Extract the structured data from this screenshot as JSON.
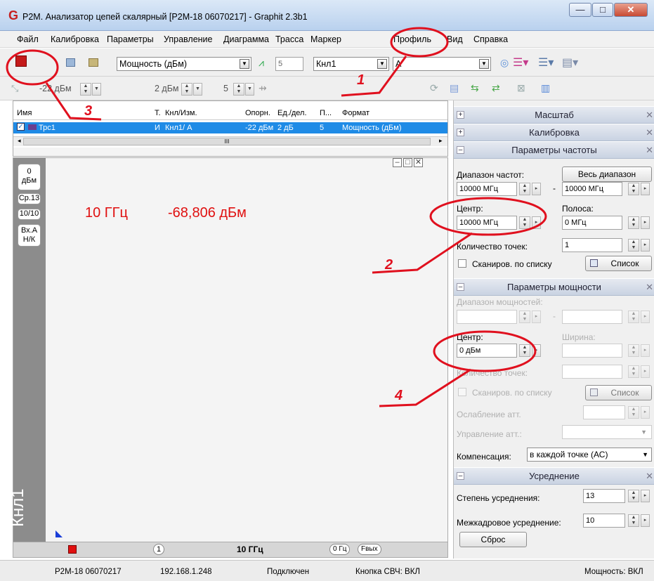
{
  "window": {
    "title": "P2M. Анализатор цепей скалярный [P2M-18 06070217] - Graphit 2.3b1",
    "logo": "G",
    "minimize": "—",
    "maximize": "□",
    "close": "✕"
  },
  "menu": [
    "Файл",
    "Калибровка",
    "Параметры",
    "Управление",
    "Диаграмма",
    "Трасса",
    "Маркер",
    "Профиль",
    "Вид",
    "Справка"
  ],
  "toolbar1": {
    "measure_combo": "Мощность (дБм)",
    "num5": "5",
    "channel_combo": "Кнл1",
    "port_combo": "A"
  },
  "toolbar2": {
    "ref_value": "-22 дБм",
    "scale_value": "2 дБм",
    "div_value": "5"
  },
  "trace_table": {
    "headers": [
      "Имя",
      "Т.",
      "Кнл/Изм.",
      "Опорн.",
      "Ед./дел.",
      "П...",
      "Формат"
    ],
    "row": [
      "Трс1",
      "И",
      "Кнл1/ A",
      "-22 дБм",
      "2 дБ",
      "5",
      "Мощность (дБм)"
    ],
    "scroll_label": "III"
  },
  "plot": {
    "freq_readout": "10 ГГц",
    "power_readout": "-68,806 дБм",
    "side_tabs": [
      "0\nдБм",
      "Ср.13",
      "10/10",
      "Вх.А\nН/К"
    ],
    "channel_label": "Кнл1",
    "bottom": {
      "marker_num": "1",
      "freq": "10 ГГц",
      "zero_hz": "0 Гц",
      "out_btn": "Fвых"
    }
  },
  "panels": {
    "scale": "Масштаб",
    "calibration": "Калибровка",
    "freq": {
      "title": "Параметры частоты",
      "range_label": "Диапазон частот:",
      "full_range_btn": "Весь диапазон",
      "start": "10000 МГц",
      "stop": "10000 МГц",
      "dash": "-",
      "center_label": "Центр:",
      "center": "10000 МГц",
      "span_label": "Полоса:",
      "span": "0 МГц",
      "points_label": "Количество точек:",
      "points": "1",
      "list_scan": "Сканиров. по списку",
      "list_btn": "Список"
    },
    "power": {
      "title": "Параметры мощности",
      "range_label": "Диапазон мощностей:",
      "dash": "-",
      "center_label": "Центр:",
      "width_label": "Ширина:",
      "center": "0 дБм",
      "points_label": "Количество точек:",
      "list_scan": "Сканиров. по списку",
      "list_btn": "Список",
      "atten_label": "Ослабление атт.",
      "atten_ctrl_label": "Управление атт.:",
      "comp_label": "Компенсация:",
      "comp_value": "в каждой точке (АС)"
    },
    "avg": {
      "title": "Усреднение",
      "degree_label": "Степень усреднения:",
      "degree": "13",
      "interframe_label": "Межкадровое усреднение:",
      "interframe": "10",
      "reset_btn": "Сброс"
    }
  },
  "statusbar": [
    "P2M-18 06070217",
    "192.168.1.248",
    "Подключен",
    "Кнопка СВЧ: ВКЛ",
    "Мощность: ВКЛ"
  ],
  "annotations": [
    "1",
    "2",
    "3",
    "4"
  ],
  "colors": {
    "annotation": "#e0101e",
    "readout": "#e01010",
    "selection": "#1f8be6"
  }
}
